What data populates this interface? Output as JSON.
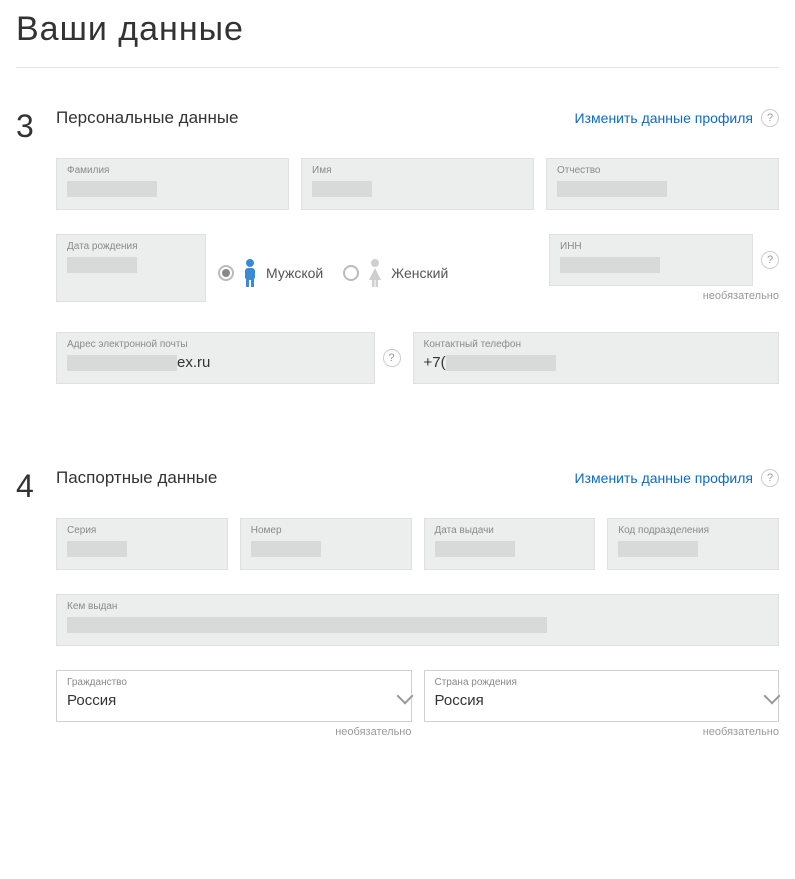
{
  "pageTitle": "Ваши данные",
  "editLinkLabel": "Изменить данные профиля",
  "optionalHint": "необязательно",
  "section3": {
    "num": "3",
    "title": "Персональные данные",
    "fields": {
      "surnameLabel": "Фамилия",
      "nameLabel": "Имя",
      "patronymicLabel": "Отчество",
      "dobLabel": "Дата рождения",
      "innLabel": "ИНН",
      "emailLabel": "Адрес электронной почты",
      "emailValueSuffix": "ex.ru",
      "phoneLabel": "Контактный телефон",
      "phoneValuePrefix": "+7("
    },
    "gender": {
      "maleLabel": "Мужской",
      "femaleLabel": "Женский",
      "selected": "male"
    }
  },
  "section4": {
    "num": "4",
    "title": "Паспортные данные",
    "fields": {
      "seriesLabel": "Серия",
      "numberLabel": "Номер",
      "issueDateLabel": "Дата выдачи",
      "deptCodeLabel": "Код подразделения",
      "issuedByLabel": "Кем выдан",
      "citizenshipLabel": "Гражданство",
      "citizenshipValue": "Россия",
      "birthCountryLabel": "Страна рождения",
      "birthCountryValue": "Россия"
    }
  }
}
